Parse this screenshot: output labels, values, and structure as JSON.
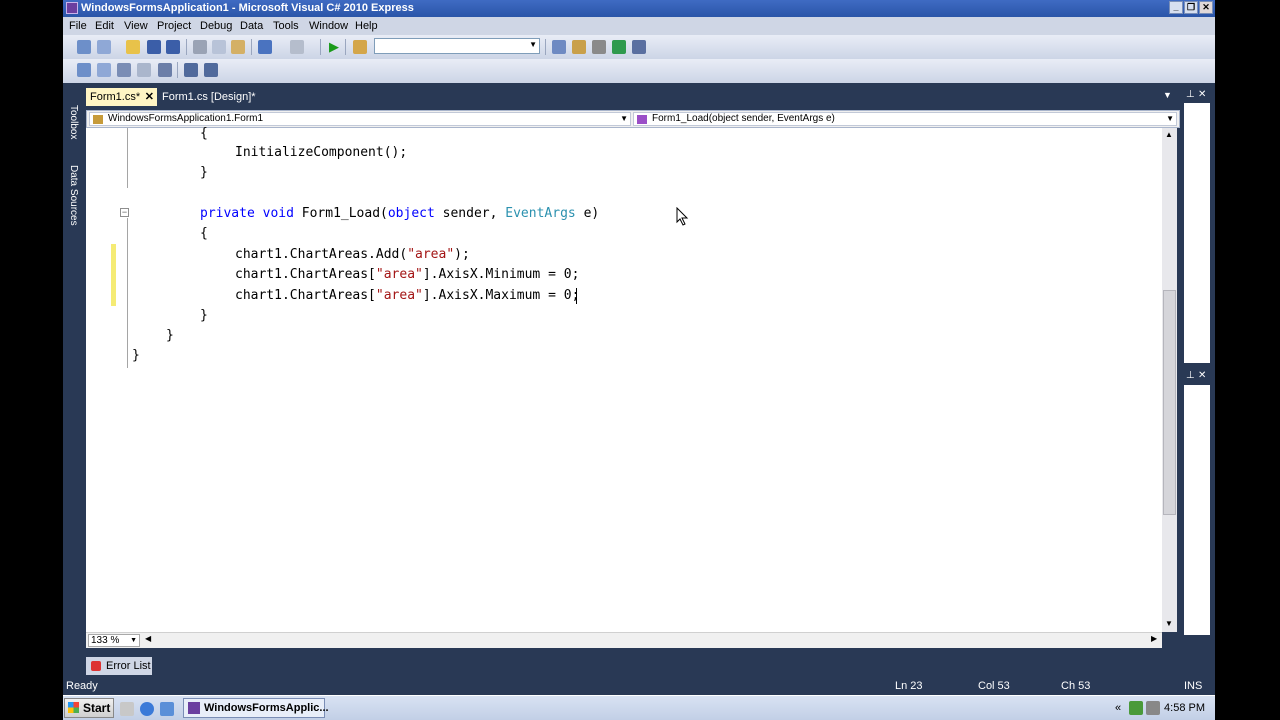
{
  "window": {
    "title": "WindowsFormsApplication1 - Microsoft Visual C# 2010 Express"
  },
  "menu": [
    "File",
    "Edit",
    "View",
    "Project",
    "Debug",
    "Data",
    "Tools",
    "Window",
    "Help"
  ],
  "left_dock": {
    "toolbox": "Toolbox",
    "data_sources": "Data Sources"
  },
  "tabs": [
    {
      "label": "Form1.cs*",
      "active": true,
      "close": "✕"
    },
    {
      "label": "Form1.cs [Design]*",
      "active": false
    }
  ],
  "nav": {
    "class_combo": "WindowsFormsApplication1.Form1",
    "member_combo": "Form1_Load(object sender, EventArgs e)"
  },
  "code": {
    "line1": "{",
    "line2": "InitializeComponent();",
    "line3": "}",
    "sig_kw1": "private",
    "sig_kw2": "void",
    "sig_name": "Form1_Load(",
    "sig_kw3": "object",
    "sig_mid": "sender,",
    "sig_type": "EventArgs",
    "sig_end": "e)",
    "line5": "{",
    "add_pre": "chart1.ChartAreas.Add(",
    "add_str": "\"area\"",
    "add_post": ");",
    "min_pre": "chart1.ChartAreas[",
    "min_str": "\"area\"",
    "min_post": "].AxisX.Minimum = 0;",
    "max_pre": "chart1.ChartAreas[",
    "max_str": "\"area\"",
    "max_post": "].AxisX.Maximum = 0;",
    "close_method": "}",
    "close_class": "}",
    "close_ns": "}"
  },
  "zoom": "133 %",
  "bottom_tab": "Error List",
  "status": {
    "ready": "Ready",
    "ln": "Ln 23",
    "col": "Col 53",
    "ch": "Ch 53",
    "ins": "INS"
  },
  "taskbar": {
    "start": "Start",
    "task": "WindowsFormsApplic...",
    "clock": "4:58 PM"
  },
  "colors": {
    "keyword": "#0000ff",
    "type": "#2b91af",
    "string": "#a31515",
    "chrome": "#293955"
  }
}
